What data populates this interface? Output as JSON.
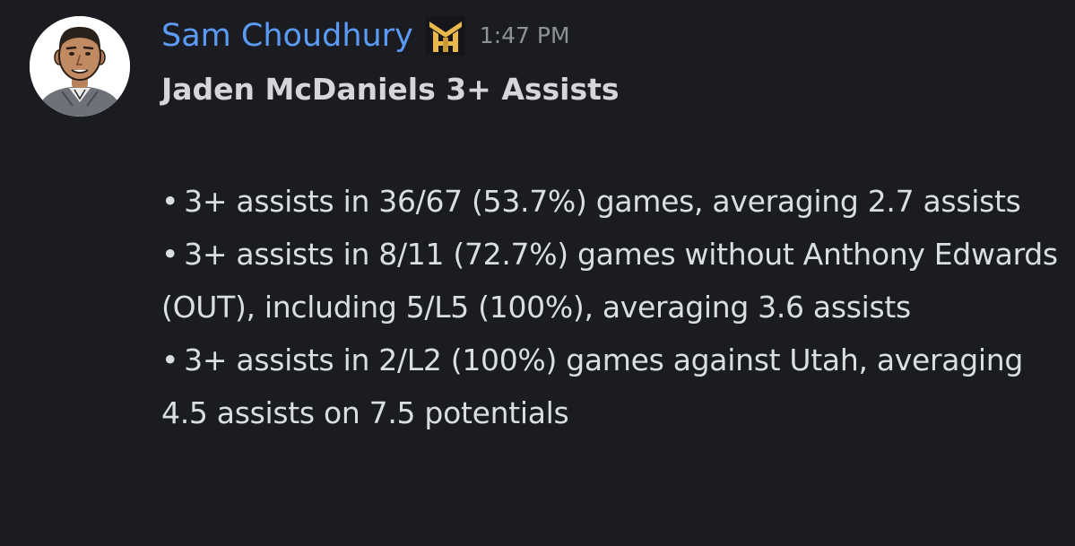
{
  "message": {
    "author": {
      "name": "Sam Choudhury",
      "name_color": "#5b9bf5",
      "avatar_icon": "cartoon-man-avatar",
      "badge_icon": "gold-monogram-badge"
    },
    "timestamp": "1:47 PM",
    "title": "Jaden McDaniels 3+ Assists",
    "bullet_symbol": "•",
    "bullets": [
      "3+ assists in 36/67 (53.7%) games, averaging 2.7 assists",
      "3+ assists in 8/11 (72.7%) games without Anthony Edwards (OUT), including 5/L5 (100%), averaging 3.6 assists",
      "3+ assists in 2/L2 (100%) games against Utah, averaging 4.5 assists on 7.5 potentials"
    ]
  },
  "colors": {
    "background": "#1b1c21",
    "text": "#dbdee1",
    "muted": "#8e9297",
    "badge_gold": "#e8b84a"
  }
}
